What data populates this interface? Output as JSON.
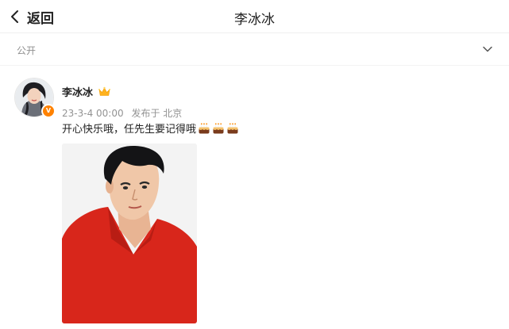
{
  "header": {
    "back_label": "返回",
    "title": "李冰冰"
  },
  "visibility": {
    "label": "公开"
  },
  "post": {
    "author": "李冰冰",
    "date": "23-3-4 00:00",
    "published_from": "发布于 北京",
    "text": "开心快乐哦，任先生要记得哦",
    "emoji_count": 3
  },
  "icons": {
    "back": "chevron-left-icon",
    "expand": "chevron-down-icon",
    "vip": "crown-icon",
    "verified": "verified-badge-icon",
    "emoji": "birthday-cake-icon"
  },
  "colors": {
    "accent": "#ff8200",
    "meta_text": "#939393",
    "photo_bg": "#f2f2f2",
    "shirt": "#d8261b"
  }
}
